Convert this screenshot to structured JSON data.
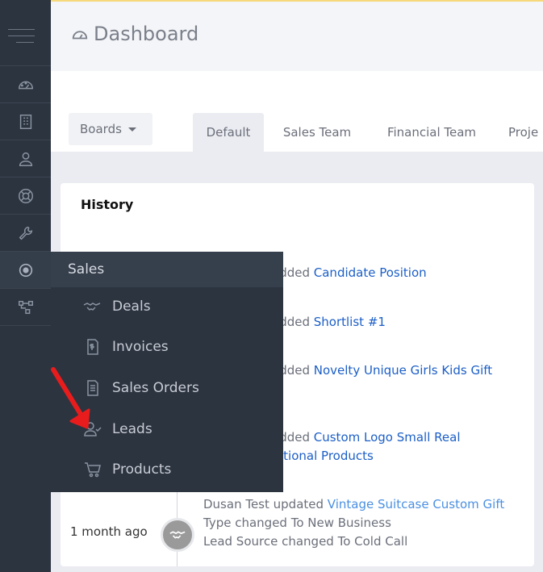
{
  "header": {
    "title": "Dashboard"
  },
  "boards_button": "Boards",
  "tabs": [
    {
      "label": "Default",
      "active": true
    },
    {
      "label": "Sales Team",
      "active": false
    },
    {
      "label": "Financial Team",
      "active": false
    },
    {
      "label": "Proje",
      "active": false
    }
  ],
  "history": {
    "title": "History",
    "items": [
      {
        "prefix": "added ",
        "link": "Candidate Position"
      },
      {
        "prefix": "added ",
        "link": "Shortlist #1"
      },
      {
        "prefix": "added ",
        "link": "Novelty Unique Girls Kids Gift"
      },
      {
        "prefix": "added ",
        "link": "Custom Logo Small Real",
        "link2": "otional Products"
      },
      {
        "time": "1 month ago",
        "prefix": "Dusan Test updated ",
        "link": "Vintage Suitcase Custom Gift",
        "line2": "Type  changed To New Business",
        "line3": "Lead Source  changed To Cold Call"
      }
    ]
  },
  "sales_menu": {
    "title": "Sales",
    "items": [
      {
        "label": "Deals",
        "icon": "handshake-icon"
      },
      {
        "label": "Invoices",
        "icon": "invoice-icon"
      },
      {
        "label": "Sales Orders",
        "icon": "sales-order-icon"
      },
      {
        "label": "Leads",
        "icon": "leads-icon"
      },
      {
        "label": "Products",
        "icon": "cart-icon"
      }
    ]
  },
  "sidebar": {
    "items": [
      {
        "icon": "dashboard-icon"
      },
      {
        "icon": "building-icon"
      },
      {
        "icon": "user-icon"
      },
      {
        "icon": "lifebuoy-icon"
      },
      {
        "icon": "wrench-icon"
      },
      {
        "icon": "sales-target-icon",
        "active": true
      },
      {
        "icon": "workflow-icon"
      }
    ]
  },
  "colors": {
    "sidebar": "#2c3440",
    "link": "#1c5fc7",
    "link_light": "#4a90e2",
    "arrow": "#e81c1c"
  }
}
